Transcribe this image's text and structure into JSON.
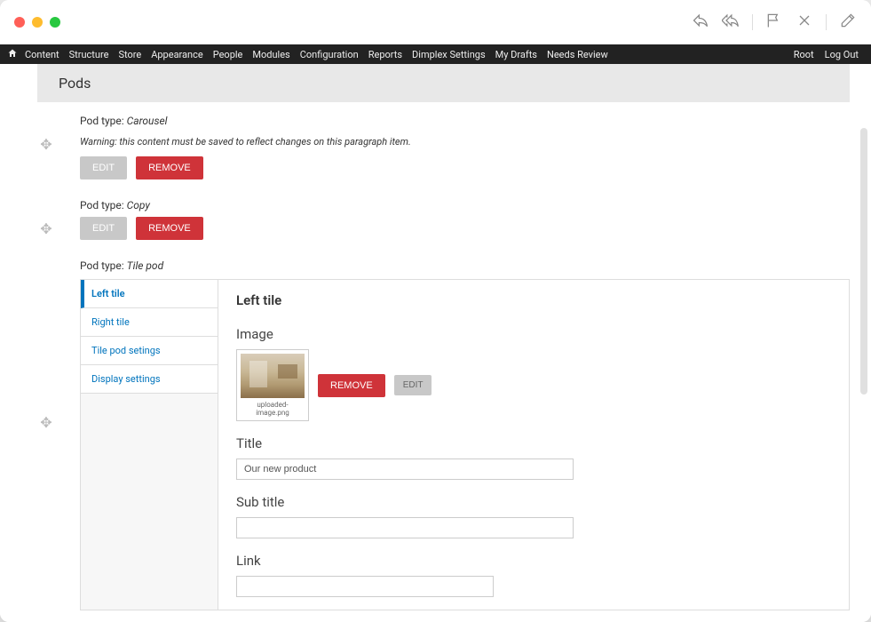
{
  "adminMenu": {
    "items": [
      "Content",
      "Structure",
      "Store",
      "Appearance",
      "People",
      "Modules",
      "Configuration",
      "Reports",
      "Dimplex Settings",
      "My Drafts",
      "Needs Review"
    ],
    "rightItems": [
      "Root",
      "Log Out"
    ]
  },
  "podsHeader": "Pods",
  "pods": [
    {
      "typeLabel": "Pod type: ",
      "typeValue": "Carousel",
      "warning": "Warning: this content must be saved to reflect changes on this paragraph item.",
      "editLabel": "EDIT",
      "removeLabel": "REMOVE"
    },
    {
      "typeLabel": "Pod type: ",
      "typeValue": "Copy",
      "editLabel": "EDIT",
      "removeLabel": "REMOVE"
    },
    {
      "typeLabel": "Pod type: ",
      "typeValue": "Tile pod"
    }
  ],
  "tilePod": {
    "tabs": [
      "Left tile",
      "Right tile",
      "Tile pod setings",
      "Display settings"
    ],
    "activeTab": "Left tile",
    "panelTitle": "Left tile",
    "imageSection": {
      "label": "Image",
      "filename": "uploaded-image.png",
      "removeLabel": "REMOVE",
      "editLabel": "EDIT"
    },
    "titleField": {
      "label": "Title",
      "value": "Our new product"
    },
    "subtitleField": {
      "label": "Sub title",
      "value": ""
    },
    "linkField": {
      "label": "Link",
      "value": ""
    }
  }
}
